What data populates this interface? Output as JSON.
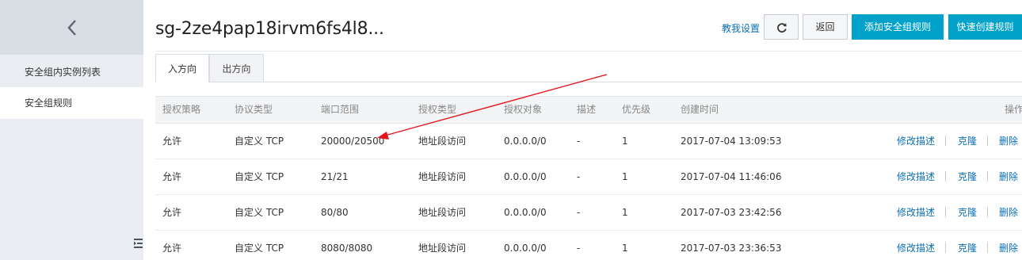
{
  "sidebar": {
    "back_icon": "chevron-left-icon",
    "items": [
      {
        "label": "安全组内实例列表"
      },
      {
        "label": "安全组规则",
        "active": true
      }
    ],
    "collapse_icon": "list-collapse-icon"
  },
  "header": {
    "title": "sg-2ze4pap18irvm6fs4l8...",
    "help_link": "教我设置",
    "refresh_icon": "refresh-icon",
    "back_label": "返回",
    "add_rule_label": "添加安全组规则",
    "quick_create_label": "快速创建规则"
  },
  "tabs": [
    {
      "label": "入方向",
      "active": true
    },
    {
      "label": "出方向",
      "active": false
    }
  ],
  "table": {
    "columns": [
      "授权策略",
      "协议类型",
      "端口范围",
      "授权类型",
      "授权对象",
      "描述",
      "优先级",
      "创建时间",
      "操作"
    ],
    "rows": [
      {
        "policy": "允许",
        "protocol": "自定义 TCP",
        "port": "20000/20500",
        "auth_type": "地址段访问",
        "object": "0.0.0.0/0",
        "desc": "-",
        "priority": "1",
        "created": "2017-07-04 13:09:53"
      },
      {
        "policy": "允许",
        "protocol": "自定义 TCP",
        "port": "21/21",
        "auth_type": "地址段访问",
        "object": "0.0.0.0/0",
        "desc": "-",
        "priority": "1",
        "created": "2017-07-04 11:46:06"
      },
      {
        "policy": "允许",
        "protocol": "自定义 TCP",
        "port": "80/80",
        "auth_type": "地址段访问",
        "object": "0.0.0.0/0",
        "desc": "-",
        "priority": "1",
        "created": "2017-07-03 23:42:56"
      },
      {
        "policy": "允许",
        "protocol": "自定义 TCP",
        "port": "8080/8080",
        "auth_type": "地址段访问",
        "object": "0.0.0.0/0",
        "desc": "-",
        "priority": "1",
        "created": "2017-07-03 23:36:53"
      }
    ],
    "actions": {
      "edit": "修改描述",
      "clone": "克隆",
      "delete": "删除"
    }
  },
  "annotation": {
    "color": "#e8141c"
  },
  "colors": {
    "primary": "#00a2ca",
    "link": "#0b6fb3",
    "sidebar_bg": "#eaedf1"
  }
}
